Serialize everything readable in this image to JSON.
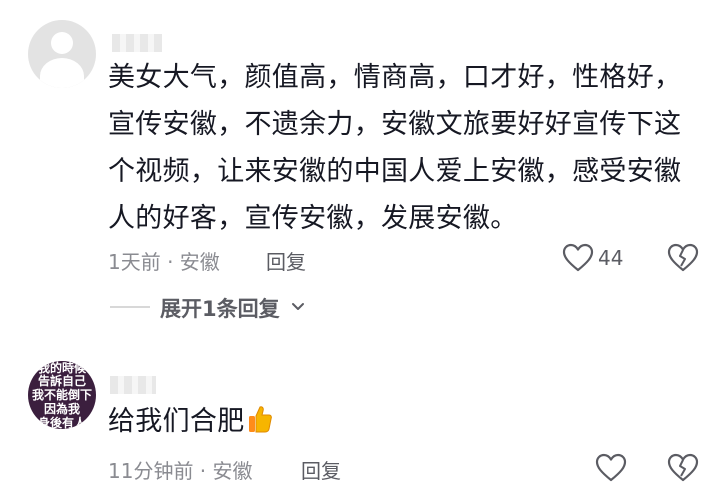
{
  "comments": [
    {
      "text": "美女大气，颜值高，情商高，口才好，性格好，宣传安徽，不遗余力，安徽文旅要好好宣传下这个视频，让来安徽的中国人爱上安徽，感受安徽人的好客，宣传安徽，发展安徽。",
      "meta": "1天前 · 安徽",
      "reply_label": "回复",
      "like_count": "44",
      "expand_label": "展开1条回复"
    },
    {
      "avatar_lines": [
        "我的時候",
        "告訴自己",
        "我不能倒下",
        "因為我",
        "身後有人"
      ],
      "text": "给我们合肥",
      "emoji": "thumbs-up-icon",
      "meta": "11分钟前 · 安徽",
      "reply_label": "回复"
    }
  ],
  "colors": {
    "text": "#161823",
    "meta": "#8a8b91",
    "action": "#5b5c63"
  }
}
